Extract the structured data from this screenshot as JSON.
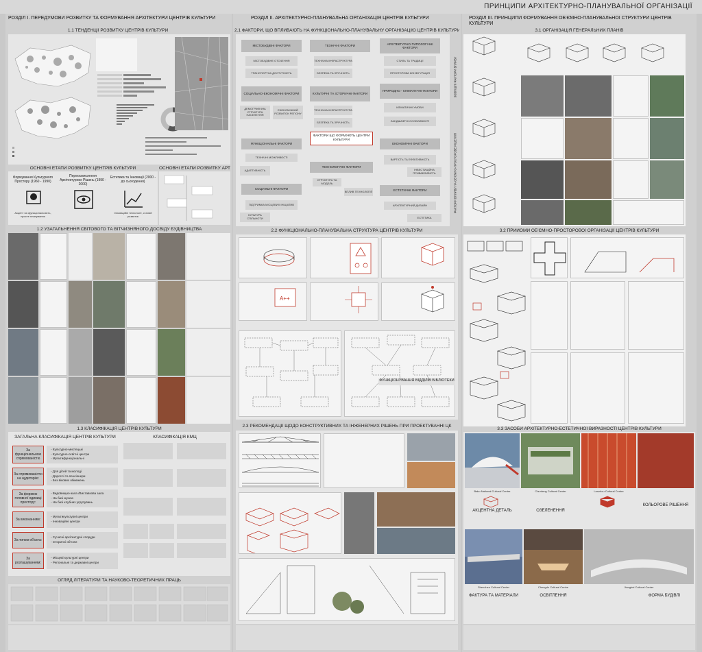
{
  "main_title": "Принципи архітектурно-планувальної організації",
  "section1": {
    "heading": "Розділ І. Передумови розвитку та формування архітектури центрів культури",
    "s11": "1.1 Тенденції розвитку центрів культури",
    "stages_heading": "Основні етапи розвитку центрів культури",
    "stages_heading2": "Основні етапи розвитку АРТ-РЕЗИДЕНЦІЙ",
    "stages": [
      {
        "label": "Формування Культурного Простору (1960 - 1990)"
      },
      {
        "label": "Переосмислення Архітектурних Рішень (1990 - 2000)"
      },
      {
        "label": "Естетика та Інновації (2000 - до сьогодення)"
      }
    ],
    "s12": "1.2 Узагальнення світового та вітчизняного досвіду будівництва",
    "s13": "1.3 Класифікація центрів культури",
    "general_class": "Загальна класифікація центрів культури",
    "class_kmc": "Класифікація КМЦ",
    "classes": [
      {
        "box": "За функціональною спрямованістю",
        "items": [
          "- Культурно-мистецькі",
          "- Культурно-освітні центри",
          "- Мультифункціональні"
        ]
      },
      {
        "box": "За спрямованістю на аудиторію:",
        "items": [
          "- Для дітей та молоді",
          "- Дорослі та пенсіонери",
          "- Без вікових обмежень"
        ]
      },
      {
        "box": "За формою головної одиниці простору:",
        "items": [
          "- Видовищно-зала /Виставкова зала",
          "- На базі музею",
          "- На базі клубних угрупувань"
        ]
      },
      {
        "box": "За виконанням:",
        "items": [
          "- Мультикультурні центри",
          "- Інноваційні центри"
        ]
      },
      {
        "box": "За типом об'єкта:",
        "items": [
          "- Сучасні архітектурні споруди",
          "- Історичні об'єкти"
        ]
      },
      {
        "box": "За розташуванням:",
        "items": [
          "- Місцеві культурні центри",
          "- Регіональні та державні центри"
        ]
      }
    ],
    "review_heading": "Огляд літератури та науково-теоретичних праць"
  },
  "section2": {
    "heading": "Розділ ІІ. Архітектурно-планувальна організація центрів культури",
    "s21": "2.1 Фактори, що впливають на функціонально-планувальну організацію центрів культури",
    "center_factor": "Фактори що формують центри культури",
    "factors": [
      {
        "name": "Містобудівні фактори",
        "subs": [
          "Містобудівне оточення",
          "Транспортна доступність"
        ]
      },
      {
        "name": "Технічні фактори",
        "subs": [
          "Технічна інфраструктура",
          "Безпека та зручність"
        ]
      },
      {
        "name": "Архітектурно-типологічні фактори",
        "subs": [
          "Стиль та традиції",
          "Просторова конфігурація"
        ]
      },
      {
        "name": "Соціально-економічні фактори",
        "subs": [
          "Демографічна структура населення",
          "Економічний розвиток регіону"
        ]
      },
      {
        "name": "Культурні та історичні фактори",
        "subs": [
          "Технічна інфраструктура",
          "Безпека та зручність"
        ]
      },
      {
        "name": "Природно - кліматичні фактори",
        "subs": [
          "Кліматичні умови",
          "Ландшафтні особливості"
        ]
      },
      {
        "name": "Функціональні фактори",
        "subs": [
          "Технічні можливості",
          "Адаптивність"
        ]
      },
      {
        "name": "Технологічні фактори",
        "subs": [
          "Структура та модель",
          "Вплив технологій"
        ]
      },
      {
        "name": "Економічні фактори",
        "subs": [
          "Вартість та ефективність",
          "Інвестиційна привабливість"
        ]
      },
      {
        "name": "Соціальні фактори",
        "subs": [
          "Підтримка місцевих ініціатив",
          "Культура спільноти"
        ]
      },
      {
        "name": "Естетичні фактори",
        "subs": [
          "Архітектурний дизайн",
          "Естетика"
        ]
      }
    ],
    "side_label_1": "Зовнішні фактори впливу",
    "side_label_2": "Фактори впливу на об'ємно-просторове рішення",
    "s22": "2.2 Функціонально-планувальна структура центрів культури",
    "library_label": "Функціонування відділів бібліотеки",
    "s23": "2.3 Рекомендації щодо конструктивних та інженерних рішень при проектуванні ЦК"
  },
  "section3": {
    "heading": "Розділ ІІІ. Принципи формування об'ємно-планувальної структури центрів культури",
    "s31": "3.1 Організація генеральних планів",
    "s32": "3.2 Прийоми об'ємно-просторової організації центрів культури",
    "s33": "3.3 Засоби архітектурно-естетичної виразності центрів культури",
    "aesthetic": [
      {
        "name": "Акцентна деталь",
        "caption": "Bako National Cultural Centre"
      },
      {
        "name": "Озеленення",
        "caption": "Chunfeng Cultural Center"
      },
      {
        "name": "Кольорове рішення",
        "caption": "Lanzhou Cultural Centre"
      },
      {
        "name": "Фактура та матеріали",
        "caption": "Shenzhen Cultural Center"
      },
      {
        "name": "Освітлення",
        "caption": "Chengdu Cultural Centre"
      },
      {
        "name": "Форма будівлі",
        "caption": "Jiangbei Cultural Center"
      }
    ]
  },
  "colors": {
    "accent": "#c0392b",
    "panel": "#e6e6e6",
    "bg": "#c9c9c9"
  }
}
